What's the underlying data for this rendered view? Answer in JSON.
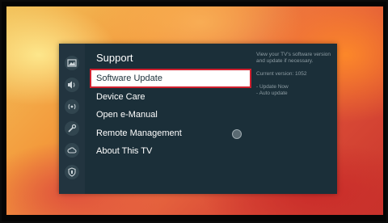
{
  "menu": {
    "title": "Support",
    "items": [
      {
        "label": "Software Update",
        "selected": true
      },
      {
        "label": "Device Care",
        "selected": false
      },
      {
        "label": "Open e-Manual",
        "selected": false
      },
      {
        "label": "Remote Management",
        "selected": false,
        "toggle": "off"
      },
      {
        "label": "About This TV",
        "selected": false
      }
    ]
  },
  "rail": {
    "icons": [
      "picture-icon",
      "sound-icon",
      "broadcast-icon",
      "general-icon",
      "cloud-icon",
      "shield-icon"
    ]
  },
  "info": {
    "description": "View your TV's software version and update if necessary.",
    "version": "Current version: 1052",
    "options": [
      "- Update Now",
      "- Auto update"
    ]
  },
  "colors": {
    "panel": "#1b2f39",
    "rail": "#22343f",
    "highlight": "#d1202f"
  }
}
